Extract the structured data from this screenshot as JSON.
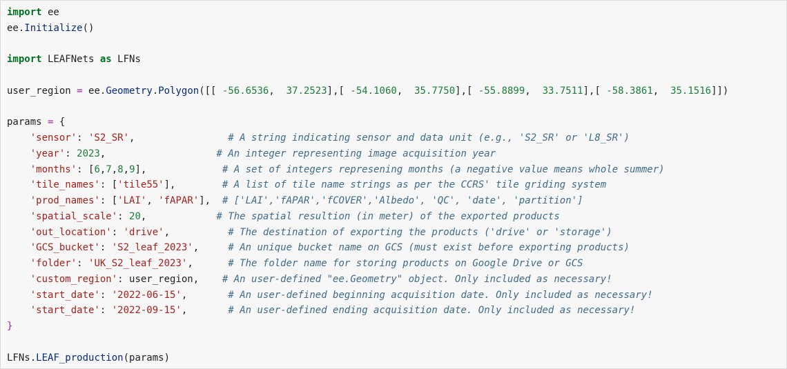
{
  "colors": {
    "background": "#f7f7f7",
    "keyword": "#007020",
    "function": "#06287e",
    "number": "#1a7f37",
    "string": "#a8201a",
    "comment": "#3f6b8a"
  },
  "code": {
    "l1": {
      "kw": "import",
      "mod": " ee"
    },
    "l2": {
      "obj": "ee.",
      "fn": "Initialize",
      "rest": "()"
    },
    "l4": {
      "kw1": "import",
      "mod": " LEAFNets ",
      "kw2": "as",
      "alias": " LFNs"
    },
    "l6": {
      "var": "user_region ",
      "eq": "=",
      "mid": " ee.",
      "fn1": "Geometry",
      "dot": ".",
      "fn2": "Polygon",
      "open": "([[ ",
      "n1": "-56.6536",
      "c1": ",  ",
      "n2": "37.2523",
      "s1": "],[ ",
      "n3": "-54.1060",
      "c2": ",  ",
      "n4": "35.7750",
      "s2": "],[ ",
      "n5": "-55.8899",
      "c3": ",  ",
      "n6": "33.7511",
      "s3": "],[ ",
      "n7": "-58.3861",
      "c4": ",  ",
      "n8": "35.1516",
      "close": "]])"
    },
    "l8": {
      "var": "params ",
      "eq": "=",
      "brace": " {"
    },
    "params": [
      {
        "indent": "    ",
        "key": "'sensor'",
        "colon": ": ",
        "value": "'S2_SR'",
        "value_kind": "str",
        "trail": ",",
        "pad": "                ",
        "comment": "# A string indicating sensor and data unit (e.g., 'S2_SR' or 'L8_SR')"
      },
      {
        "indent": "    ",
        "key": "'year'",
        "colon": ": ",
        "value": "2023",
        "value_kind": "num",
        "trail": ",",
        "pad": "                   ",
        "comment": "# An integer representing image acquisition year"
      },
      {
        "indent": "    ",
        "key": "'months'",
        "colon": ": ",
        "value": "[6,7,8,9]",
        "value_kind": "list-num",
        "trail": ",",
        "pad": "             ",
        "comment": "# A set of integers represening months (a negative value means whole summer)"
      },
      {
        "indent": "    ",
        "key": "'tile_names'",
        "colon": ": ",
        "value": "['tile55']",
        "value_kind": "list-str",
        "trail": ",",
        "pad": "        ",
        "comment": "# A list of tile name strings as per the CCRS' tile griding system"
      },
      {
        "indent": "    ",
        "key": "'prod_names'",
        "colon": ": ",
        "value": "['LAI', 'fAPAR']",
        "value_kind": "list-str",
        "trail": ",",
        "pad": "  ",
        "comment": "# ['LAI','fAPAR','fCOVER','Albedo', 'QC', 'date', 'partition']"
      },
      {
        "indent": "    ",
        "key": "'spatial_scale'",
        "colon": ": ",
        "value": "20",
        "value_kind": "num",
        "trail": ",",
        "pad": "            ",
        "comment": "# The spatial resultion (in meter) of the exported products"
      },
      {
        "indent": "    ",
        "key": "'out_location'",
        "colon": ": ",
        "value": "'drive'",
        "value_kind": "str",
        "trail": ",",
        "pad": "          ",
        "comment": "# The destination of exporting the products ('drive' or 'storage')"
      },
      {
        "indent": "    ",
        "key": "'GCS_bucket'",
        "colon": ": ",
        "value": "'S2_leaf_2023'",
        "value_kind": "str",
        "trail": ",",
        "pad": "     ",
        "comment": "# An unique bucket name on GCS (must exist before exporting products)"
      },
      {
        "indent": "    ",
        "key": "'folder'",
        "colon": ": ",
        "value": "'UK_S2_leaf_2023'",
        "value_kind": "str",
        "trail": ",",
        "pad": "      ",
        "comment": "# The folder name for storing products on Google Drive or GCS"
      },
      {
        "indent": "    ",
        "key": "'custom_region'",
        "colon": ": ",
        "value": "user_region",
        "value_kind": "plain",
        "trail": ",",
        "pad": "    ",
        "comment": "# An user-defined \"ee.Geometry\" object. Only included as necessary!"
      },
      {
        "indent": "    ",
        "key": "'start_date'",
        "colon": ": ",
        "value": "'2022-06-15'",
        "value_kind": "str",
        "trail": ",",
        "pad": "       ",
        "comment": "# An user-defined beginning acquisition date. Only included as necessary!"
      },
      {
        "indent": "    ",
        "key": "'start_date'",
        "colon": ": ",
        "value": "'2022-09-15'",
        "value_kind": "str",
        "trail": ",",
        "pad": "       ",
        "comment": "# An user-defined ending acquisition date. Only included as necessary!"
      }
    ],
    "l21": {
      "brace": "}"
    },
    "l23": {
      "obj": "LFNs.",
      "fn": "LEAF_production",
      "rest": "(params)"
    }
  }
}
